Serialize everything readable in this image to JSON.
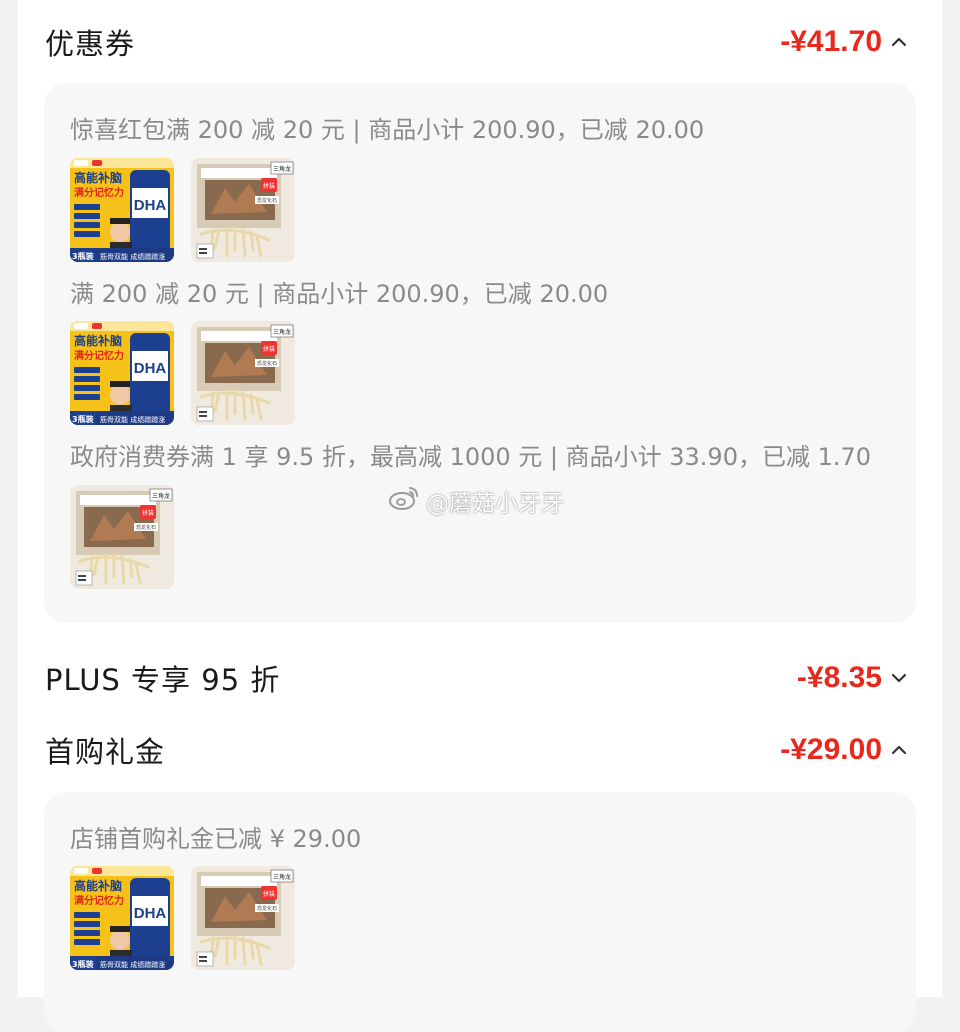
{
  "coupon": {
    "title": "优惠券",
    "amount": "-¥41.70",
    "chevron": "chevron-up-icon",
    "entries": [
      {
        "desc": "惊喜红包满 200 减 20 元 | 商品小计 200.90，已减 20.00",
        "products": [
          "dha-supplement",
          "dino-fossil-kit"
        ]
      },
      {
        "desc": "满 200 减 20 元 | 商品小计 200.90，已减 20.00",
        "products": [
          "dha-supplement",
          "dino-fossil-kit"
        ]
      },
      {
        "desc": "政府消费券满 1 享 9.5 折，最高减 1000 元 | 商品小计 33.90，已减 1.70",
        "products": [
          "dino-fossil-kit"
        ]
      }
    ]
  },
  "plus": {
    "title": "PLUS 专享 95 折",
    "amount": "-¥8.35",
    "chevron": "chevron-down-icon"
  },
  "first_purchase": {
    "title": "首购礼金",
    "amount": "-¥29.00",
    "chevron": "chevron-up-icon",
    "entries": [
      {
        "desc": "店铺首购礼金已减 ¥ 29.00",
        "products": [
          "dha-supplement",
          "dino-fossil-kit"
        ]
      }
    ]
  },
  "product_images": {
    "dha": {
      "headline": "高能补脑",
      "subline": "满分记忆力",
      "label": "DHA",
      "badge": "3瓶装",
      "footer": "筋骨双能 成绩蹭蹭涨"
    },
    "dino": {
      "corner_tag": "三角龙",
      "sticker": "拼装",
      "box_label": "恐龙化石"
    }
  },
  "watermark": {
    "text": "@蘑菇小牙牙",
    "icon": "weibo-icon"
  },
  "colors": {
    "accent": "#e8281c",
    "muted_text": "#8a8a8a",
    "box_bg": "#f7f7f7"
  }
}
